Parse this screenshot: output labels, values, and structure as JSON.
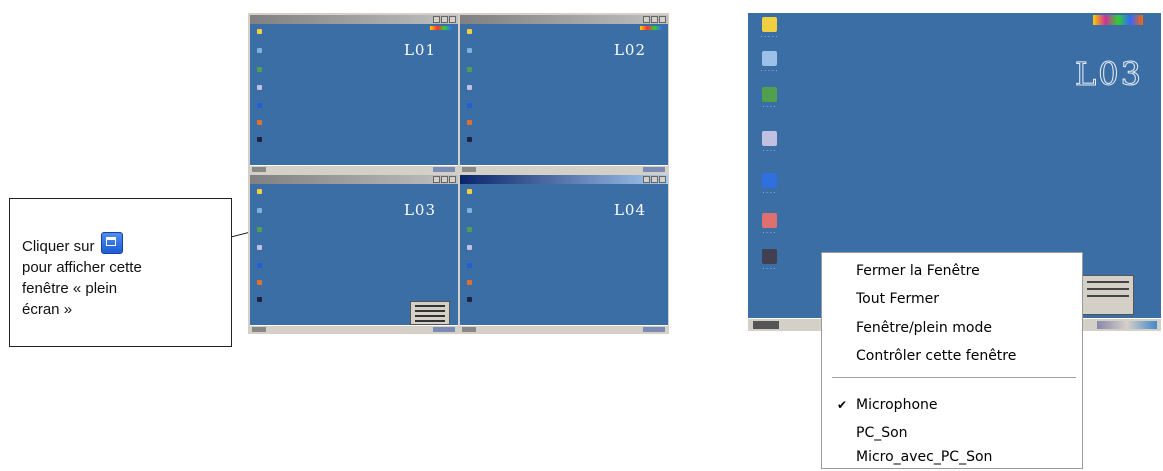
{
  "callout": {
    "line1": "Cliquer sur",
    "line2": "pour afficher cette",
    "line3": "fenêtre « plein",
    "line4": "écran »",
    "icon": "maximize-window-icon"
  },
  "grid": {
    "panes": [
      {
        "label": "L01"
      },
      {
        "label": "L02"
      },
      {
        "label": "L03"
      },
      {
        "label": "L04"
      }
    ]
  },
  "big_screen": {
    "label": "L03"
  },
  "context_menu": {
    "items": [
      {
        "label": "Fermer la Fenêtre"
      },
      {
        "label": "Tout Fermer"
      },
      {
        "label": "Fenêtre/plein mode"
      },
      {
        "label": "Contrôler cette fenêtre"
      },
      {
        "label": "Microphone",
        "checked": true
      },
      {
        "label": "PC_Son"
      },
      {
        "label": "Micro_avec_PC_Son"
      }
    ]
  },
  "colors": {
    "desktop": "#3a6ea5",
    "window_chrome": "#d4d0c8"
  }
}
